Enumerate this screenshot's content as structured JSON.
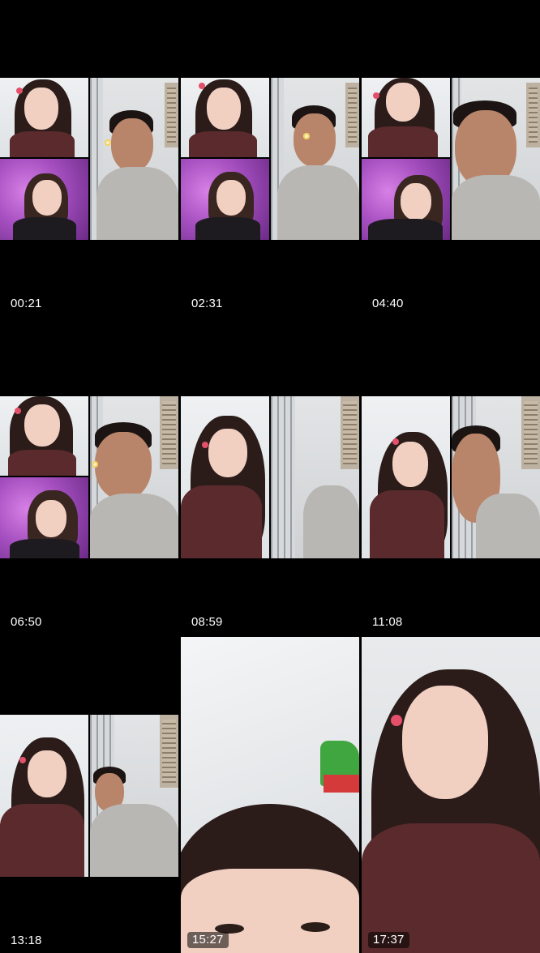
{
  "gallery": {
    "thumbnails": [
      {
        "timestamp": "00:21"
      },
      {
        "timestamp": "02:31"
      },
      {
        "timestamp": "04:40"
      },
      {
        "timestamp": "06:50"
      },
      {
        "timestamp": "08:59"
      },
      {
        "timestamp": "11:08"
      },
      {
        "timestamp": "13:18"
      },
      {
        "timestamp": "15:27"
      },
      {
        "timestamp": "17:37"
      }
    ]
  },
  "colors": {
    "background": "#000000",
    "timestamp_text": "#ffffff",
    "purple_bg": "#a54fc0",
    "dress": "#5a2a2c"
  }
}
